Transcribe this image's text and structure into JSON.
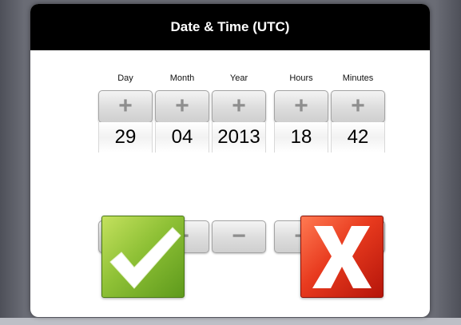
{
  "dialog": {
    "title": "Date & Time (UTC)"
  },
  "fields": [
    {
      "label": "Day",
      "value": "29",
      "increment_symbol": "+",
      "decrement_symbol": "−"
    },
    {
      "label": "Month",
      "value": "04",
      "increment_symbol": "+",
      "decrement_symbol": "−"
    },
    {
      "label": "Year",
      "value": "2013",
      "increment_symbol": "+",
      "decrement_symbol": "−"
    },
    {
      "label": "Hours",
      "value": "18",
      "increment_symbol": "+",
      "decrement_symbol": "−"
    },
    {
      "label": "Minutes",
      "value": "42",
      "increment_symbol": "+",
      "decrement_symbol": "−"
    }
  ],
  "actions": {
    "confirm_icon": "checkmark-icon",
    "cancel_icon": "x-icon"
  },
  "colors": {
    "title_bar": "#000000",
    "confirm": "#8fc136",
    "cancel": "#e83a1e",
    "background": "#6a6c75"
  }
}
